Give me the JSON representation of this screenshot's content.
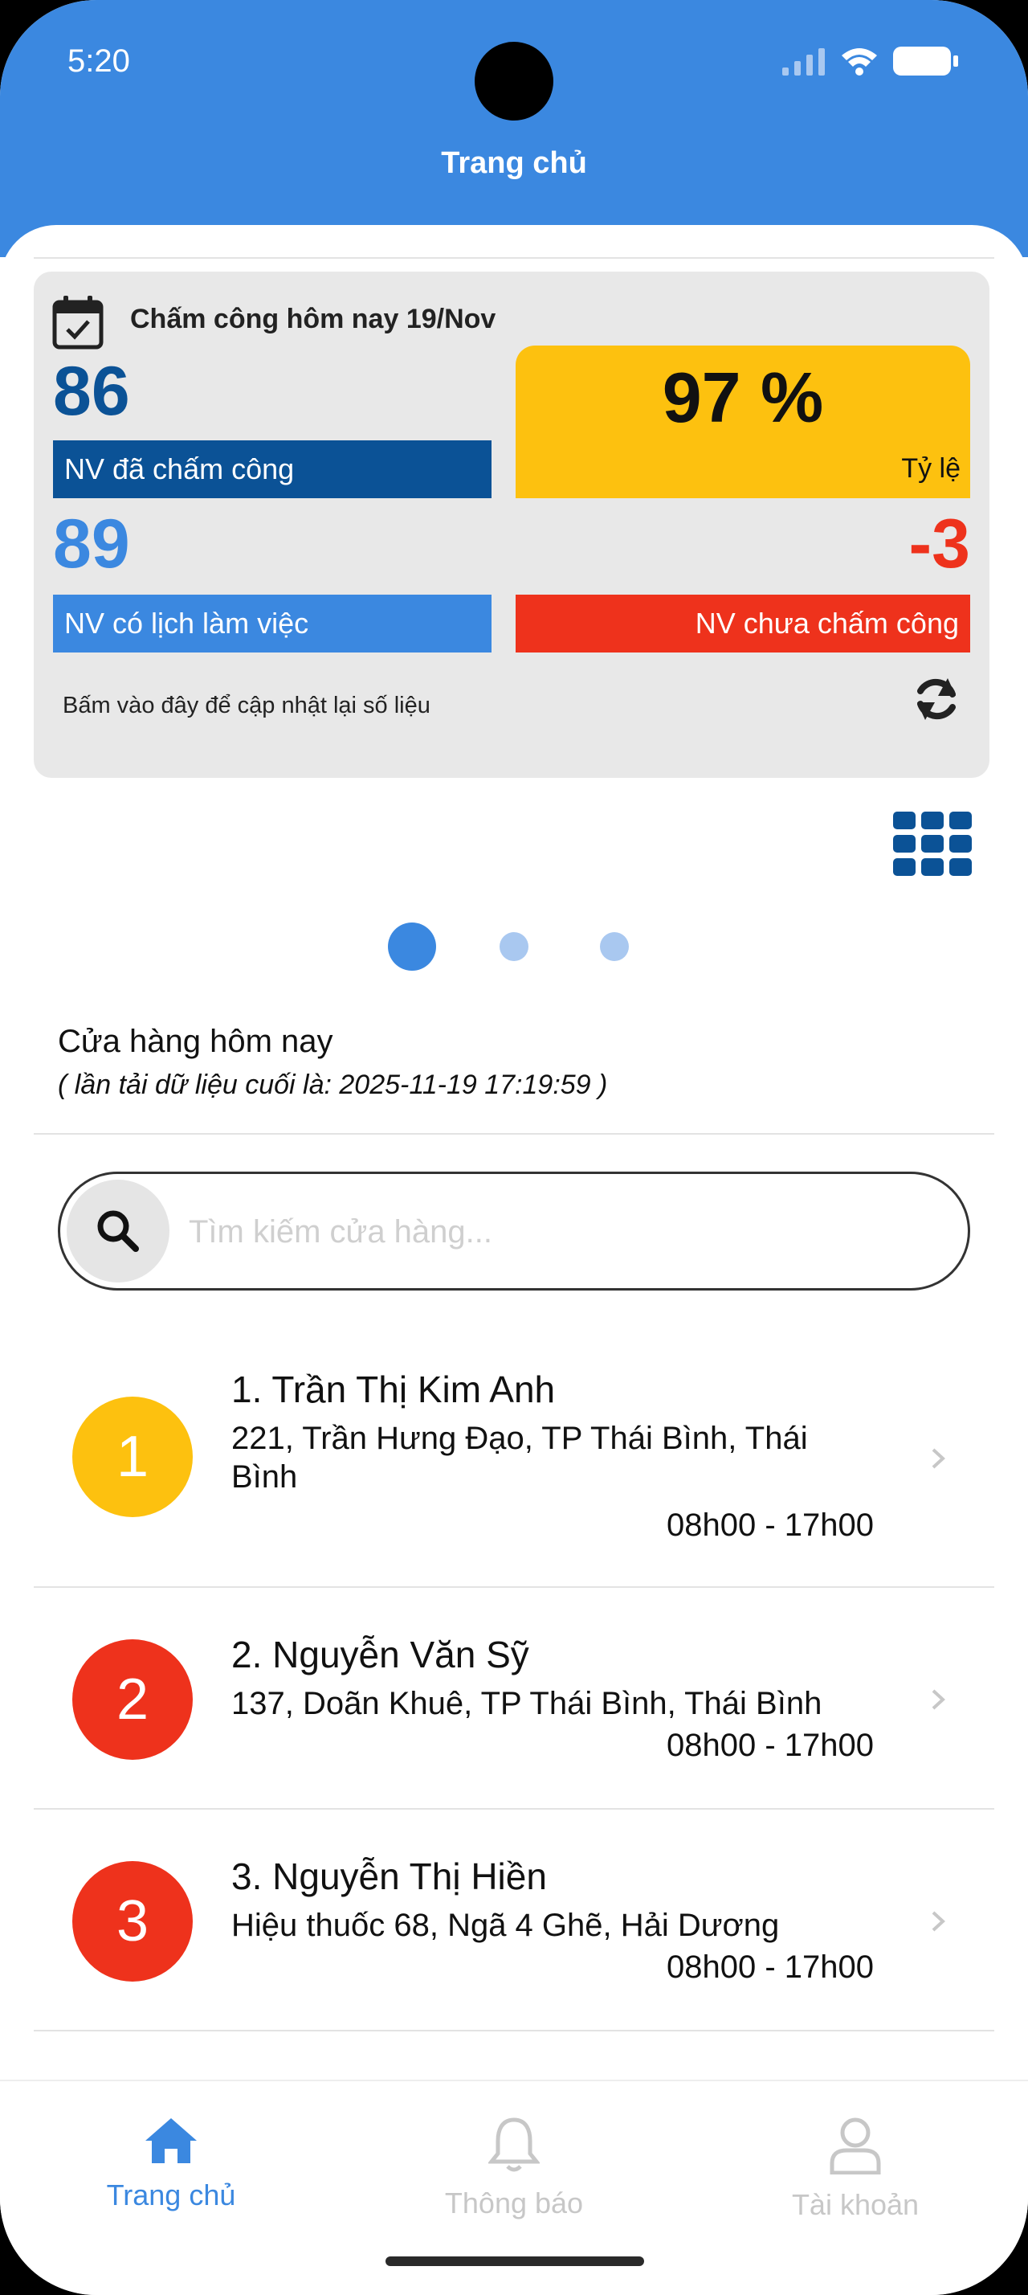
{
  "status_bar": {
    "time": "5:20"
  },
  "header": {
    "title": "Trang chủ"
  },
  "attendance": {
    "title": "Chấm công hôm nay 19/Nov",
    "checked_in_count": "86",
    "checked_in_label": "NV đã chấm công",
    "scheduled_count": "89",
    "scheduled_label": "NV có lịch làm việc",
    "rate_value": "97 %",
    "rate_label": "Tỷ lệ",
    "missing_count": "-3",
    "missing_label": "NV chưa chấm công",
    "refresh_hint": "Bấm vào đây để cập nhật lại số liệu",
    "colors": {
      "dark_blue": "#0b5296",
      "light_blue": "#3b88e0",
      "yellow": "#fdc10f",
      "red": "#ee321c"
    }
  },
  "carousel": {
    "page_count": 3,
    "active_index": 0
  },
  "stores": {
    "title": "Cửa hàng hôm nay",
    "last_loaded": "( lần tải dữ liệu cuối là: 2025-11-19 17:19:59 )",
    "search_placeholder": "Tìm kiếm cửa hàng...",
    "items": [
      {
        "number": "1",
        "name": "1. Trần Thị Kim Anh",
        "address": "221, Trần Hưng Đạo, TP Thái Bình, Thái Bình",
        "hours": "08h00 - 17h00",
        "color": "#fdc10f"
      },
      {
        "number": "2",
        "name": "2. Nguyễn Văn Sỹ",
        "address": "137, Doãn Khuê, TP Thái Bình, Thái Bình",
        "hours": "08h00 - 17h00",
        "color": "#ee321c"
      },
      {
        "number": "3",
        "name": "3. Nguyễn Thị Hiền",
        "address": "Hiệu thuốc 68, Ngã 4 Ghẽ, Hải Dương",
        "hours": "08h00 - 17h00",
        "color": "#ee321c"
      }
    ]
  },
  "tabbar": {
    "items": [
      {
        "label": "Trang chủ",
        "icon": "home-icon",
        "active": true
      },
      {
        "label": "Thông báo",
        "icon": "bell-icon",
        "active": false
      },
      {
        "label": "Tài khoản",
        "icon": "user-icon",
        "active": false
      }
    ],
    "active_color": "#3b88e0",
    "inactive_color": "#c7c7c7"
  }
}
